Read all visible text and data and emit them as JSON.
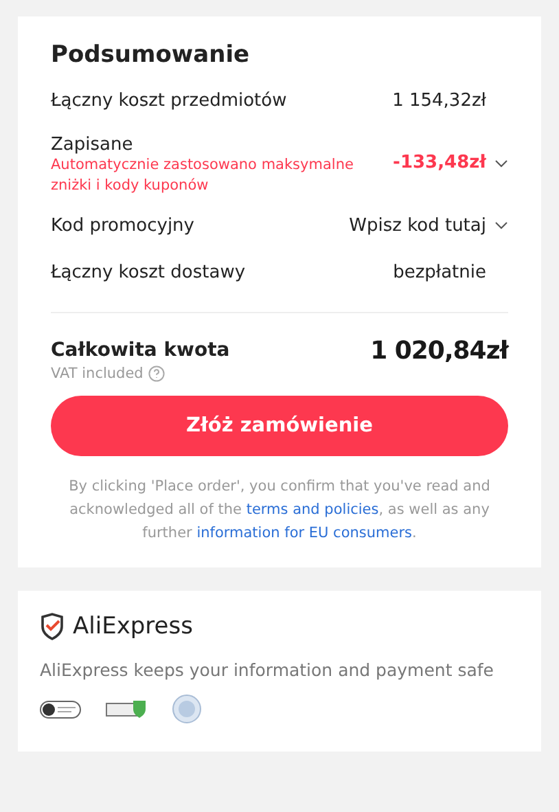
{
  "summary": {
    "title": "Podsumowanie",
    "rows": [
      {
        "kind": "plain",
        "label": "Łączny koszt przedmiotów",
        "value": "1 154,32zł"
      },
      {
        "kind": "discount",
        "label": "Zapisane",
        "note": "Automatycznie zastosowano maksymalne zniżki i kody kuponów",
        "value": "-133,48zł"
      },
      {
        "kind": "dropdown",
        "label": "Kod promocyjny",
        "value": "Wpisz kod tutaj"
      },
      {
        "kind": "plain",
        "label": "Łączny koszt dostawy",
        "value": "bezpłatnie"
      }
    ],
    "total": {
      "label": "Całkowita kwota",
      "value": "1 020,84zł",
      "vat": "VAT included"
    },
    "button": "Złóż zamówienie",
    "legal": {
      "before": "By clicking 'Place order', you confirm that you've read and acknowledged all of the ",
      "link1": "terms and policies",
      "middle": ", as well as any further ",
      "link2": "information for EU consumers",
      "after": "."
    }
  },
  "trust": {
    "brand": "AliExpress",
    "message": "AliExpress keeps your information and payment safe"
  }
}
